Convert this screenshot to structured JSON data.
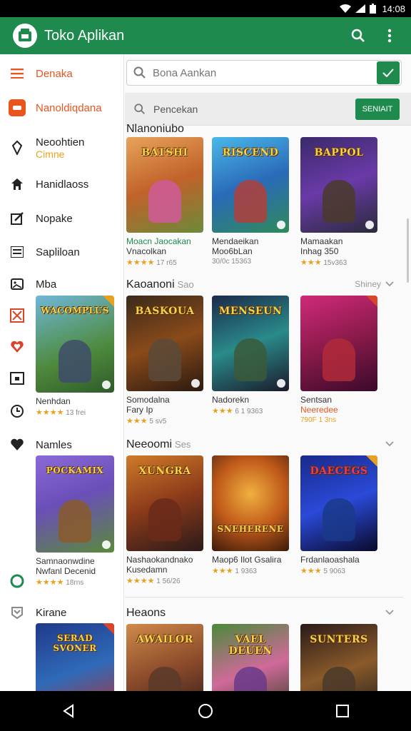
{
  "status": {
    "time": "14:08"
  },
  "appbar": {
    "title": "Toko Aplikan",
    "search_icon": "search-icon",
    "menu_icon": "more-vert-icon",
    "color": "#1e8a4e"
  },
  "sidebar": {
    "items": [
      {
        "label": "Denaka",
        "icon": "menu-icon"
      },
      {
        "label": "Nanoldiqdana",
        "icon": "badge-icon"
      },
      {
        "label": "Neoohtien",
        "sublabel": "Cimne",
        "icon": "tag-icon"
      },
      {
        "label": "Hanidlaoss",
        "icon": "home-icon"
      },
      {
        "label": "Nopake",
        "icon": "edit-icon"
      },
      {
        "label": "Sapliloan",
        "icon": "list-icon"
      },
      {
        "label": "Mba",
        "icon": "image-icon"
      },
      {
        "label": "Namles",
        "icon": "heart-icon"
      },
      {
        "label": "Kirane",
        "icon": "shield-icon"
      }
    ],
    "cards": [
      {
        "name": "WACOMPLUS",
        "title": "Nenhdan",
        "rating_text": "13 frei"
      },
      {
        "name": "POCKAMIX",
        "title": "Samnaonwdine",
        "subtitle": "Nwfanl Decenid",
        "rating_text": "18rns"
      },
      {
        "name": "SERAD SVONER",
        "title": "",
        "rating_text": ""
      }
    ]
  },
  "search": {
    "placeholder": "Bona Aankan",
    "go_icon": "check-icon"
  },
  "search2": {
    "text": "Pencekan",
    "button": "SENIAIT"
  },
  "sections": [
    {
      "title": "Nlanoniubo",
      "count": "",
      "more": "",
      "cards": [
        {
          "name": "BATSHI",
          "title": "Moacn Jaocakan",
          "subtitle": "Vnacolkan",
          "rating_text": "17 r65"
        },
        {
          "name": "RISCEND",
          "title": "Mendaeikan",
          "subtitle": "Moo6bLan",
          "rating_text": "30/0c 15363"
        },
        {
          "name": "BAPPOL",
          "title": "Mamaakan",
          "subtitle": "Inhag 350",
          "rating_text": "15v363"
        }
      ]
    },
    {
      "title": "Kaoanoni",
      "count": "Sao",
      "more": "Shiney",
      "cards": [
        {
          "name": "BASKOUA",
          "title": "Somodalna",
          "subtitle": "Fary Ip",
          "rating_text": "5 sv5"
        },
        {
          "name": "MENSEUN",
          "title": "Nadorekn",
          "subtitle": "",
          "rating_text": "6 1 9363"
        },
        {
          "name": "",
          "title": "Sentsan",
          "subtitle": "Neeredee",
          "rating_text": "790F 1 3ns"
        }
      ]
    },
    {
      "title": "Neeoomi",
      "count": "Ses",
      "more": "",
      "cards": [
        {
          "name": "XUNGRA",
          "title": "Nashaokandnako",
          "subtitle": "Kusedamn",
          "rating_text": "1 56/26"
        },
        {
          "name": "SNEHERENE",
          "title": "Maop6 Ilot Gsalira",
          "subtitle": "",
          "rating_text": "1 9363"
        },
        {
          "name": "DAECEGS",
          "title": "Frdanlaoashala",
          "subtitle": "",
          "rating_text": "5 9063"
        }
      ]
    },
    {
      "title": "Heaons",
      "count": "",
      "more": "",
      "cards": [
        {
          "name": "AWAILOR",
          "title": "",
          "subtitle": "",
          "rating_text": ""
        },
        {
          "name": "VAEL DEUEN",
          "title": "",
          "subtitle": "",
          "rating_text": ""
        },
        {
          "name": "SUNTERS",
          "title": "",
          "subtitle": "",
          "rating_text": ""
        }
      ]
    }
  ],
  "colors": {
    "accent": "#1e8a4e",
    "orange": "#e8561e",
    "star": "#e8a020"
  }
}
